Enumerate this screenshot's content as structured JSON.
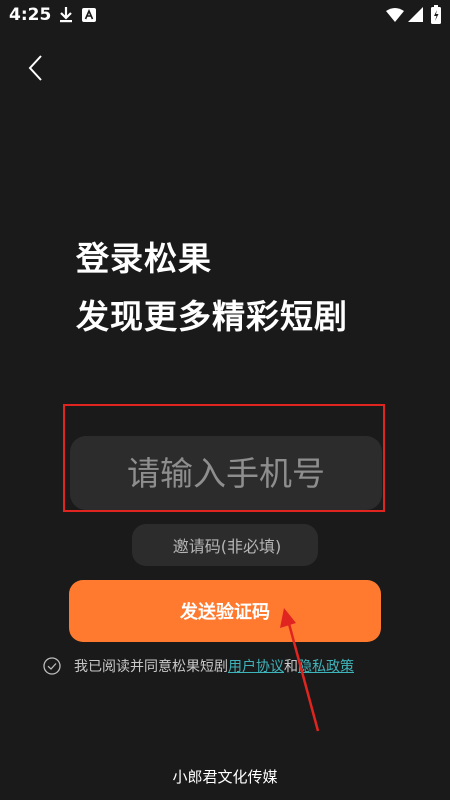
{
  "status_bar": {
    "time": "4:25",
    "left_icons": [
      "download-icon",
      "font-notification-icon"
    ],
    "right_icons": [
      "wifi-icon",
      "signal-icon",
      "battery-charging-icon"
    ]
  },
  "nav": {
    "back_icon": "chevron-left-icon"
  },
  "headline": {
    "line1": "登录松果",
    "line2": "发现更多精彩短剧"
  },
  "phone_input": {
    "placeholder": "请输入手机号",
    "value": ""
  },
  "invite_input": {
    "placeholder": "邀请码(非必填)",
    "value": ""
  },
  "send_button": {
    "label": "发送验证码"
  },
  "agreement": {
    "text": "我已阅读并同意松果短剧",
    "user_agreement": "用户协议",
    "conjunction": "和",
    "privacy_policy": "隐私政策",
    "checked": false
  },
  "footer": {
    "company": "小郎君文化传媒"
  },
  "colors": {
    "background": "#1a1a1a",
    "input_bg": "#2c2c2c",
    "accent": "#ff7a2f",
    "link": "#3fb3ba",
    "highlight": "#e0241f"
  }
}
